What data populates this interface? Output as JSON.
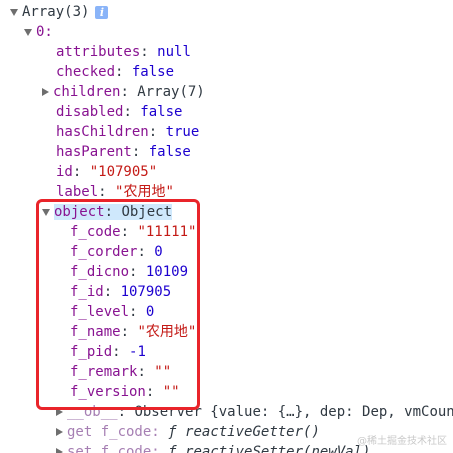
{
  "root": {
    "label": "Array(3)",
    "info_icon": "info-icon"
  },
  "item0": {
    "label": "0:"
  },
  "props": [
    {
      "key": "attributes",
      "value": "null",
      "kind": "n"
    },
    {
      "key": "checked",
      "value": "false",
      "kind": "n"
    },
    {
      "key": "children",
      "value": "Array(7)",
      "kind": "o"
    },
    {
      "key": "disabled",
      "value": "false",
      "kind": "n"
    },
    {
      "key": "hasChildren",
      "value": "true",
      "kind": "n"
    },
    {
      "key": "hasParent",
      "value": "false",
      "kind": "n"
    },
    {
      "key": "id",
      "value": "\"107905\"",
      "kind": "s"
    },
    {
      "key": "label",
      "value": "\"农用地\"",
      "kind": "s"
    }
  ],
  "object": {
    "key": "object",
    "value": "Object"
  },
  "object_props": [
    {
      "key": "f_code",
      "value": "\"11111\"",
      "kind": "s"
    },
    {
      "key": "f_corder",
      "value": "0",
      "kind": "n"
    },
    {
      "key": "f_dicno",
      "value": "10109",
      "kind": "n"
    },
    {
      "key": "f_id",
      "value": "107905",
      "kind": "n"
    },
    {
      "key": "f_level",
      "value": "0",
      "kind": "n"
    },
    {
      "key": "f_name",
      "value": "\"农用地\"",
      "kind": "s"
    },
    {
      "key": "f_pid",
      "value": "-1",
      "kind": "n"
    },
    {
      "key": "f_remark",
      "value": "\"\"",
      "kind": "s"
    },
    {
      "key": "f_version",
      "value": "\"\"",
      "kind": "s"
    }
  ],
  "ob": {
    "key": "__ob__",
    "value": "Observer {value: {…}, dep: Dep, vmCount"
  },
  "getter": {
    "prefix": "get f_code:",
    "f": "ƒ",
    "value": "reactiveGetter()"
  },
  "setter": {
    "prefix": "set f_code:",
    "f": "ƒ",
    "value": "reactiveSetter(newVal)"
  },
  "watermark": "@稀土掘金技术社区",
  "colors": {
    "highlight_box": "#e9242a",
    "selection": "#cfe8fc"
  }
}
